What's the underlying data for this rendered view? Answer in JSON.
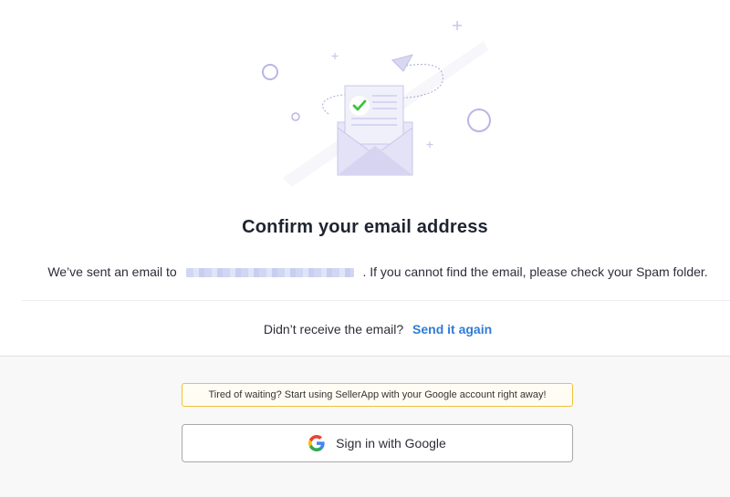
{
  "illustration": {
    "icon": "email-sent-envelope-illustration",
    "check_color": "#3cc43c"
  },
  "confirm": {
    "title": "Confirm your email address",
    "sent_prefix": "We’ve sent an email to",
    "sent_suffix": ". If you cannot find the email, please check your Spam folder."
  },
  "resend": {
    "question": "Didn’t receive the email?",
    "link_label": "Send it again"
  },
  "google": {
    "banner_text": "Tired of waiting? Start using SellerApp with your Google account right away!",
    "button_label": "Sign in with Google",
    "icon": "google-g-icon"
  },
  "colors": {
    "link": "#2f7bd8",
    "banner_border": "#f1c232",
    "accent_illustration": "#c9c7ec"
  }
}
